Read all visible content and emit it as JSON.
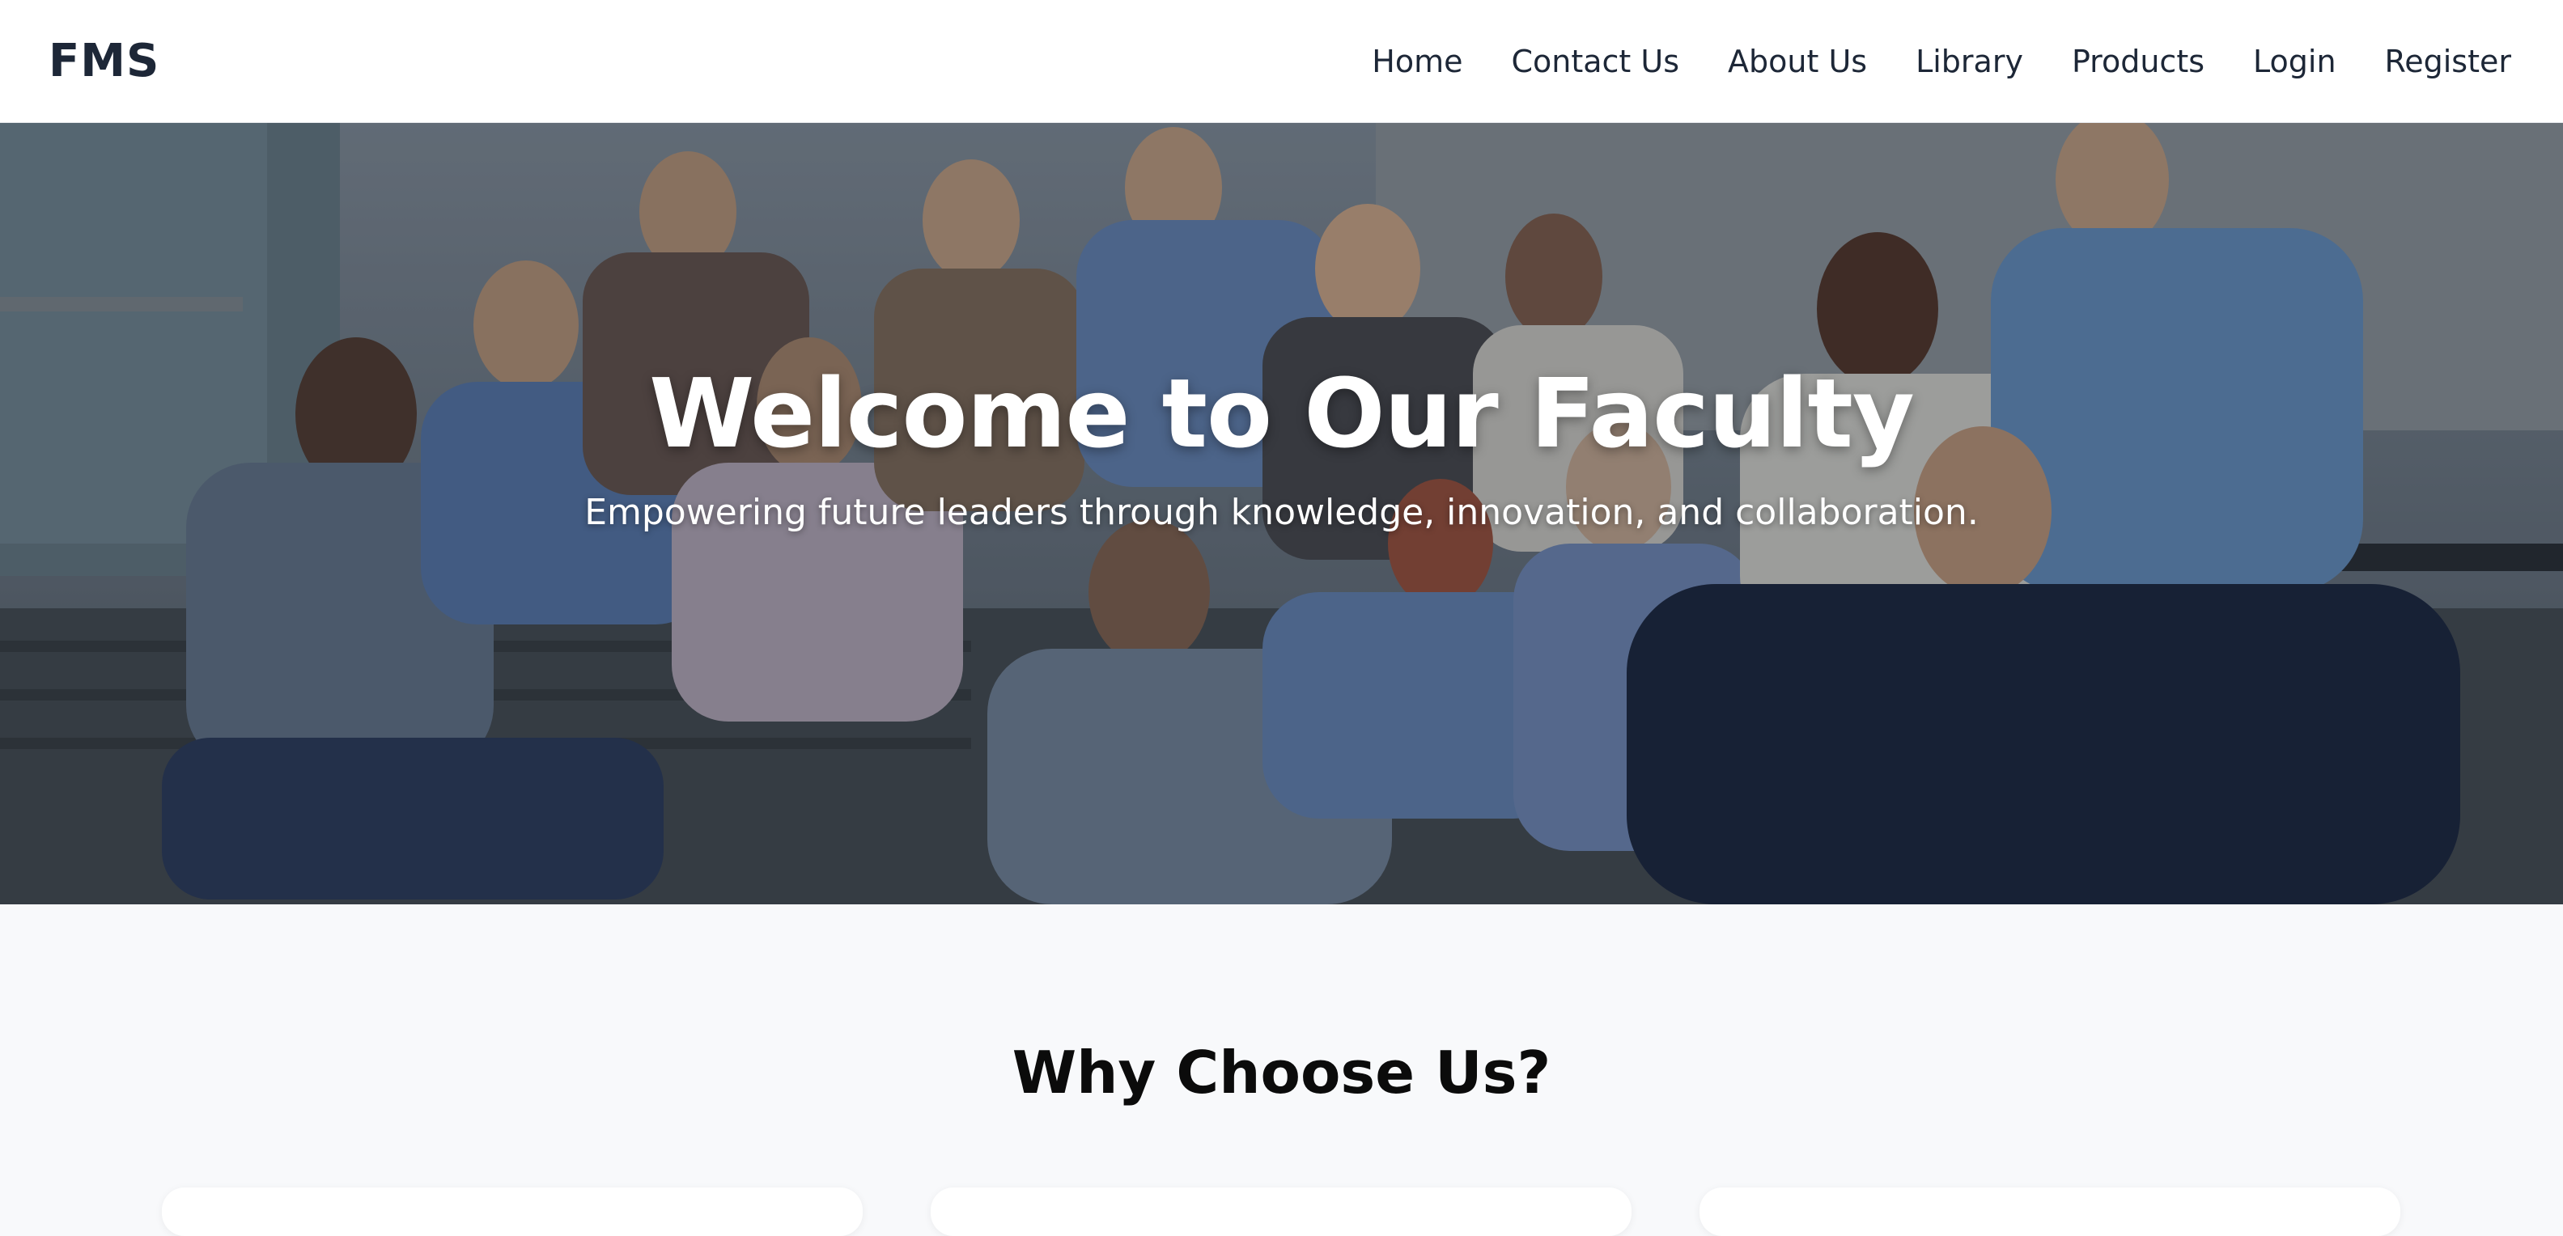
{
  "navbar": {
    "brand": "FMS",
    "links": [
      {
        "label": "Home"
      },
      {
        "label": "Contact Us"
      },
      {
        "label": "About Us"
      },
      {
        "label": "Library"
      },
      {
        "label": "Products"
      },
      {
        "label": "Login"
      },
      {
        "label": "Register"
      }
    ]
  },
  "hero": {
    "title": "Welcome to Our Faculty",
    "subtitle": "Empowering future leaders through knowledge, innovation, and collaboration.",
    "image": "group photo of smiling students waving on outdoor steps"
  },
  "why": {
    "title": "Why Choose Us?"
  },
  "colors": {
    "nav_text": "#1d2737",
    "section_bg": "#f8f9fb",
    "hero_text": "#ffffff"
  }
}
